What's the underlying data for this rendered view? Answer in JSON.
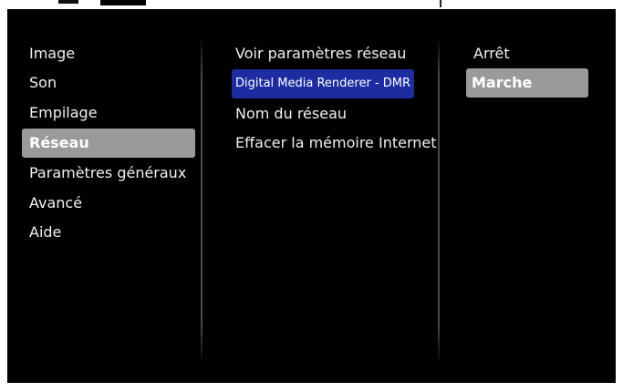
{
  "main_menu": {
    "items": [
      {
        "label": "Image"
      },
      {
        "label": "Son"
      },
      {
        "label": "Empilage"
      },
      {
        "label": "Réseau"
      },
      {
        "label": "Paramètres généraux"
      },
      {
        "label": "Avancé"
      },
      {
        "label": "Aide"
      }
    ],
    "selected": "Réseau"
  },
  "network_menu": {
    "items": [
      {
        "label": "Voir paramètres réseau"
      },
      {
        "label": "Digital Media Renderer - DMR"
      },
      {
        "label": "Nom du réseau"
      },
      {
        "label": "Effacer la mémoire Internet"
      }
    ],
    "highlighted": "Digital Media Renderer - DMR"
  },
  "options": {
    "items": [
      {
        "label": "Arrêt"
      },
      {
        "label": "Marche"
      }
    ],
    "selected": "Marche"
  },
  "colors": {
    "background": "#000000",
    "selected_bg": "#9a9a9a",
    "highlight_bg": "#1d2ca0",
    "text": "#f2f2f2"
  }
}
